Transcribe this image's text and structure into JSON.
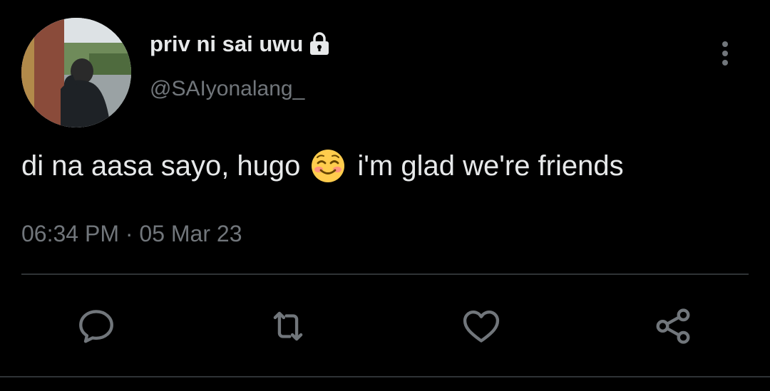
{
  "tweet": {
    "display_name": "priv ni sai uwu",
    "handle": "@SAIyonalang_",
    "text_before": "di na aasa sayo, hugo",
    "text_after": "i'm glad we're friends",
    "emoji": "smiling-face-with-smiling-eyes",
    "timestamp": "06:34 PM · 05 Mar 23"
  },
  "icons": {
    "lock": "lock-icon",
    "more": "more-vertical-icon",
    "reply": "comment-icon",
    "retweet": "retweet-icon",
    "like": "heart-icon",
    "share": "share-icon"
  },
  "colors": {
    "background": "#000000",
    "primary_text": "#e7e9ea",
    "secondary_text": "#71767b",
    "divider": "#2f3336",
    "icon": "#71767b"
  }
}
